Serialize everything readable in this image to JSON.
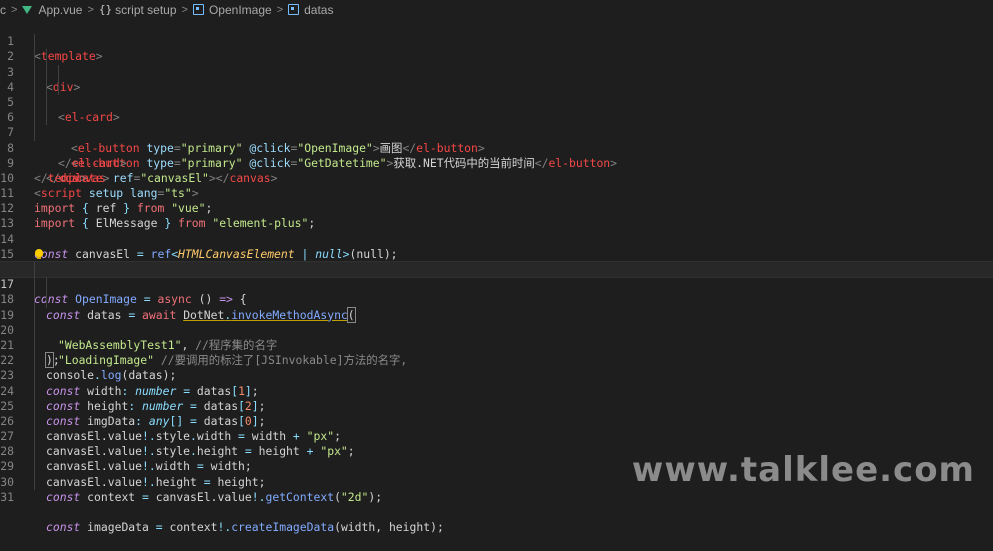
{
  "breadcrumb": {
    "root": "c",
    "file": "App.vue",
    "section": "script setup",
    "symbol1": "OpenImage",
    "symbol2": "datas"
  },
  "lines": [
    {
      "n": "1"
    },
    {
      "n": "2"
    },
    {
      "n": "3"
    },
    {
      "n": "4"
    },
    {
      "n": "5"
    },
    {
      "n": "6"
    },
    {
      "n": "7"
    },
    {
      "n": "8"
    },
    {
      "n": "9"
    },
    {
      "n": "10"
    },
    {
      "n": "11"
    },
    {
      "n": "12"
    },
    {
      "n": "13"
    },
    {
      "n": "14"
    },
    {
      "n": "15"
    },
    {
      "n": "16"
    },
    {
      "n": "17"
    },
    {
      "n": "18"
    },
    {
      "n": "19"
    },
    {
      "n": "20"
    },
    {
      "n": "21"
    },
    {
      "n": "22"
    },
    {
      "n": "23"
    },
    {
      "n": "24"
    },
    {
      "n": "25"
    },
    {
      "n": "26"
    },
    {
      "n": "27"
    },
    {
      "n": "28"
    },
    {
      "n": "29"
    },
    {
      "n": "30"
    },
    {
      "n": "31"
    }
  ],
  "code": {
    "l1": {
      "tag": "template"
    },
    "l2": {
      "tag": "div"
    },
    "l3": {
      "tag": "el-card"
    },
    "l4": {
      "tag": "el-button",
      "attr_type": "type",
      "attr_type_val": "\"primary\"",
      "attr_click": "@click",
      "attr_click_val": "\"OpenImage\"",
      "text": "画图",
      "close": "el-button"
    },
    "l5": {
      "tag": "el-button",
      "attr_type": "type",
      "attr_type_val": "\"primary\"",
      "attr_click": "@click",
      "attr_click_val": "\"GetDatetime\"",
      "text": "获取.NET代码中的当前时间",
      "close": "el-button"
    },
    "l6": {
      "tag": "el-card"
    },
    "l7": {
      "tag": "canvas",
      "attr": "ref",
      "attr_val": "\"canvasEl\"",
      "close": "canvas"
    },
    "l8": {
      "tag": "div"
    },
    "l9": {
      "tag": "template"
    },
    "l10": {
      "tag": "script",
      "attr1": "setup",
      "attr2": "lang",
      "attr2_val": "\"ts\""
    },
    "l11": {
      "kw": "import",
      "name": "ref",
      "from": "from",
      "src": "\"vue\""
    },
    "l12": {
      "kw": "import",
      "name": "ElMessage",
      "from": "from",
      "src": "\"element-plus\""
    },
    "l14": {
      "kw": "const",
      "name": "canvasEl",
      "fn": "ref",
      "type1": "HTMLCanvasElement",
      "type2": "null",
      "arg": "null"
    },
    "l16": {
      "kw_a": "c",
      "kw_b": "onst",
      "name": "OpenImage",
      "async": "async"
    },
    "l17": {
      "kw": "const",
      "name": "datas",
      "await": "await",
      "obj": "DotNet",
      "fn": "invokeMethodAsync"
    },
    "l18": {
      "str": "\"WebAssemblyTest1\"",
      "comment": "//程序集的名字"
    },
    "l19": {
      "str": "\"LoadingImage\"",
      "comment": "//要调用的标注了[JSInvokable]方法的名字,"
    },
    "l20": {
      "text": ");"
    },
    "l21": {
      "obj": "console",
      "fn": "log",
      "arg": "datas"
    },
    "l22": {
      "kw": "const",
      "name": "width",
      "type": "number",
      "src": "datas",
      "idx": "1"
    },
    "l23": {
      "kw": "const",
      "name": "height",
      "type": "number",
      "src": "datas",
      "idx": "2"
    },
    "l24": {
      "kw": "const",
      "name": "imgData",
      "type": "any",
      "src": "datas",
      "idx": "0"
    },
    "l25": {
      "obj": "canvasEl.value",
      "prop": "style",
      "field": "width",
      "val": "width",
      "unit": "\"px\""
    },
    "l26": {
      "obj": "canvasEl.value",
      "prop": "style",
      "field": "height",
      "val": "height",
      "unit": "\"px\""
    },
    "l27": {
      "obj": "canvasEl.value",
      "field": "width",
      "val": "width"
    },
    "l28": {
      "obj": "canvasEl.value",
      "field": "height",
      "val": "height"
    },
    "l29": {
      "kw": "const",
      "name": "context",
      "obj": "canvasEl.value",
      "fn": "getContext",
      "arg": "\"2d\""
    },
    "l31": {
      "kw": "const",
      "name": "imageData",
      "obj": "context",
      "fn": "createImageData",
      "arg1": "width",
      "arg2": "height"
    }
  },
  "watermark": "www.talklee.com"
}
